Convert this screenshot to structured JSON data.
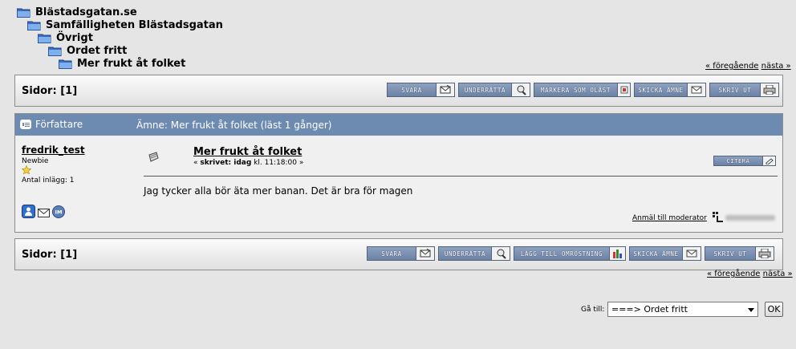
{
  "breadcrumb": [
    {
      "label": "Blästadsgatan.se"
    },
    {
      "label": "Samfälligheten Blästadsgatan"
    },
    {
      "label": "Övrigt"
    },
    {
      "label": "Ordet fritt"
    },
    {
      "label": "Mer frukt åt folket"
    }
  ],
  "nav": {
    "prev": "« föregående",
    "next": "nästa »"
  },
  "pages": {
    "label": "Sidor:",
    "value": "[1]"
  },
  "top_buttons": [
    "SVARA",
    "UNDERRÄTTA",
    "MARKERA SOM OLÄST",
    "SKICKA ÄMNE",
    "SKRIV UT"
  ],
  "bottom_buttons": [
    "SVARA",
    "UNDERRÄTTA",
    "LÄGG TILL OMRÖSTNING",
    "SKICKA ÄMNE",
    "SKRIV UT"
  ],
  "header": {
    "author": "Författare",
    "subject": "Ämne: Mer frukt åt folket  (läst 1 gånger)"
  },
  "post": {
    "username": "fredrik_test",
    "rank": "Newbie",
    "post_count": "Antal inlägg: 1",
    "title": "Mer frukt åt folket",
    "meta_prefix": "« ",
    "meta_bold": "skrivet: idag",
    "meta_rest": " kl. 11:18:00 »",
    "quote_button": "CITERA",
    "body": "Jag tycker alla bör äta mer banan. Det är bra för magen",
    "report": "Anmäl till moderator"
  },
  "jump": {
    "label": "Gå till:",
    "selected": "===> Ordet fritt",
    "ok": "OK"
  }
}
